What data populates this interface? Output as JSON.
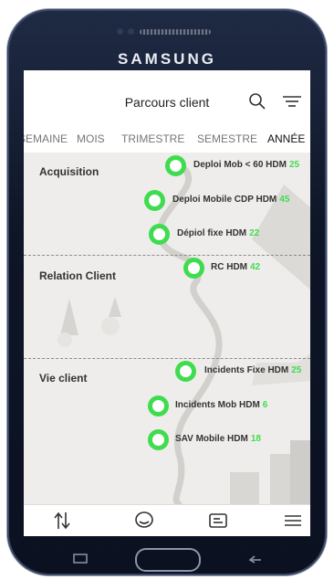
{
  "device": {
    "brand": "SAMSUNG"
  },
  "header": {
    "title": "Parcours client"
  },
  "tabs": [
    {
      "label": "SEMAINE",
      "active": false
    },
    {
      "label": "MOIS",
      "active": false
    },
    {
      "label": "TRIMESTRE",
      "active": false
    },
    {
      "label": "SEMESTRE",
      "active": false
    },
    {
      "label": "ANNÉE",
      "active": true
    }
  ],
  "sections": [
    {
      "title": "Acquisition"
    },
    {
      "title": "Relation Client"
    },
    {
      "title": "Vie client"
    }
  ],
  "milestones": [
    {
      "label": "Deploi Mob < 60 HDM",
      "value": "25"
    },
    {
      "label": "Deploi Mobile CDP HDM",
      "value": "45"
    },
    {
      "label": "Dépiol fixe HDM",
      "value": "22"
    },
    {
      "label": "RC HDM",
      "value": "42"
    },
    {
      "label": "Incidents Fixe HDM",
      "value": "25"
    },
    {
      "label": "Incidents Mob HDM",
      "value": "6"
    },
    {
      "label": "SAV Mobile HDM",
      "value": "18"
    }
  ],
  "colors": {
    "accent": "#3fdc4f",
    "screen_bg": "#efedeb"
  },
  "icons": {
    "top": [
      "search-icon",
      "filter-icon"
    ],
    "bottom": [
      "sort-arrows-icon",
      "chat-icon",
      "ticket-icon",
      "menu-icon"
    ],
    "hardware": [
      "recent-apps-icon",
      "home-button",
      "back-icon"
    ]
  }
}
